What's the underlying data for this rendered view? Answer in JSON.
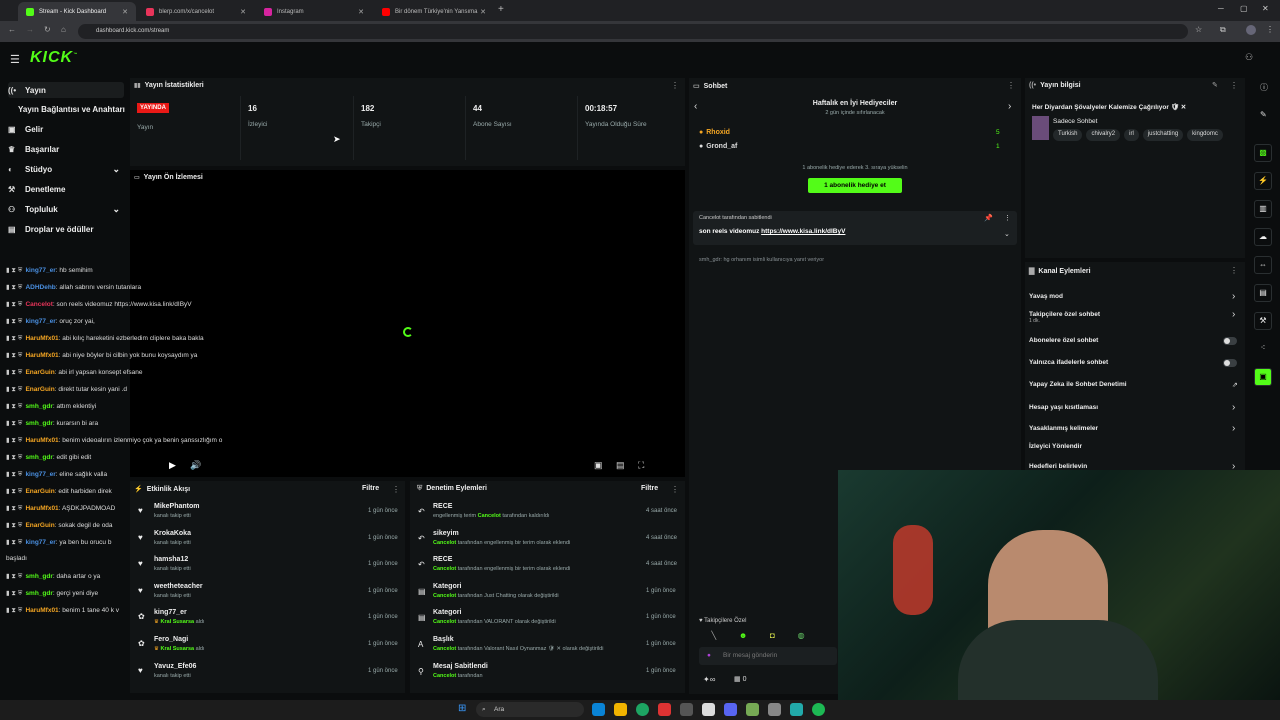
{
  "browser": {
    "tabs": [
      {
        "title": "Stream - Kick Dashboard",
        "color": "#53fc18"
      },
      {
        "title": "blerp.com/x/cancelot",
        "color": "#e8345a"
      },
      {
        "title": "Instagram",
        "color": "#d6249f"
      },
      {
        "title": "Bir dönem Türkiye'nin Yansıma",
        "color": "#ff0000"
      }
    ],
    "url": "dashboard.kick.com/stream",
    "plus": "+"
  },
  "brand": {
    "logo": "KICK",
    "tm": "™",
    "accent": "#53fc18"
  },
  "sidebar": {
    "items": [
      {
        "label": "Yayın",
        "icon": "broadcast-icon"
      },
      {
        "label": "Yayın Bağlantısı ve Anahtarı",
        "icon": ""
      },
      {
        "label": "Gelir",
        "icon": "wallet-icon"
      },
      {
        "label": "Başarılar",
        "icon": "trophy-icon"
      },
      {
        "label": "Stüdyo",
        "icon": "palette-icon"
      },
      {
        "label": "Denetleme",
        "icon": "gavel-icon"
      },
      {
        "label": "Topluluk",
        "icon": "community-icon"
      },
      {
        "label": "Droplar ve ödüller",
        "icon": "gift-icon"
      }
    ]
  },
  "stats": {
    "title": "Yayın İstatistikleri",
    "live_badge": "YAYINDA",
    "live_label": "Yayın",
    "items": [
      {
        "value": "16",
        "label": "İzleyici"
      },
      {
        "value": "182",
        "label": "Takipçi"
      },
      {
        "value": "44",
        "label": "Abone Sayısı"
      },
      {
        "value": "00:18:57",
        "label": "Yayında Olduğu Süre"
      }
    ]
  },
  "preview": {
    "title": "Yayın Ön İzlemesi"
  },
  "activity": {
    "title": "Etkinlik Akışı",
    "filter": "Filtre",
    "rows": [
      {
        "name": "MikePhantom",
        "sub": "kanalı takip etti",
        "time": "1 gün önce",
        "icon": "heart-icon"
      },
      {
        "name": "KrokaKoka",
        "sub": "kanalı takip etti",
        "time": "1 gün önce",
        "icon": "heart-icon"
      },
      {
        "name": "hamsha12",
        "sub": "kanalı takip etti",
        "time": "1 gün önce",
        "icon": "heart-icon"
      },
      {
        "name": "weetheteacher",
        "sub": "kanalı takip etti",
        "time": "1 gün önce",
        "icon": "heart-icon"
      },
      {
        "name": "king77_er",
        "sub": "Kral Susarsa",
        "sub2": "aldı",
        "time": "1 gün önce",
        "icon": "reward-icon"
      },
      {
        "name": "Fero_Nagi",
        "sub": "Kral Susarsa",
        "sub2": "aldı",
        "time": "1 gün önce",
        "icon": "reward-icon"
      },
      {
        "name": "Yavuz_Efe06",
        "sub": "kanalı takip etti",
        "time": "1 gün önce",
        "icon": "heart-icon"
      }
    ]
  },
  "moderation": {
    "title": "Denetim Eylemleri",
    "filter": "Filtre",
    "rows": [
      {
        "name": "RECE",
        "sub": "engellenmiş terim",
        "hl": "Cancelot",
        "sub2": "tarafından kaldırıldı",
        "time": "4 saat önce",
        "icon": "undo-icon"
      },
      {
        "name": "sikeyim",
        "sub": "",
        "hl": "Cancelot",
        "sub2": "tarafından engellenmiş bir terim olarak eklendi",
        "time": "4 saat önce",
        "icon": "undo-icon"
      },
      {
        "name": "RECE",
        "sub": "",
        "hl": "Cancelot",
        "sub2": "tarafından engellenmiş bir terim olarak eklendi",
        "time": "4 saat önce",
        "icon": "undo-icon"
      },
      {
        "name": "Kategori",
        "sub": "",
        "hl": "Cancelot",
        "sub2": "tarafından Just Chatting olarak değiştirildi",
        "time": "1 gün önce",
        "icon": "category-icon"
      },
      {
        "name": "Kategori",
        "sub": "",
        "hl": "Cancelot",
        "sub2": "tarafından VALORANT olarak değiştirildi",
        "time": "1 gün önce",
        "icon": "category-icon"
      },
      {
        "name": "Başlık",
        "sub": "",
        "hl": "Cancelot",
        "sub2": "tarafından Valorant Nasıl Oynanmaz 🛡 ✕ olarak değiştirildi",
        "time": "1 gün önce",
        "icon": "title-icon"
      },
      {
        "name": "Mesaj Sabitlendi",
        "sub": "",
        "hl": "Cancelot",
        "sub2": "tarafından",
        "time": "1 gün önce",
        "icon": "pin-icon"
      }
    ]
  },
  "chat": {
    "title": "Sohbet",
    "gifters_title": "Haftalık en İyi Hediyeciler",
    "gifters_sub": "2 gün içinde sıfırlanacak",
    "gifters": [
      {
        "name": "Rhoxid",
        "count": "5"
      },
      {
        "name": "Grond_af",
        "count": "1"
      }
    ],
    "gift_hint": "1 abonelik hediye ederek 3. sıraya yükselin",
    "gift_button": "1 abonelik hediye et",
    "pinned_by": "Cancelot tarafından sabitlendi",
    "pinned_text": "son reels videomuz",
    "pinned_link": "https://www.kisa.link/dIByV",
    "reply_hint": "smh_gdr: hg orhanım isimli kullanıcıya yanıt veriyor",
    "messages": [
      {
        "user": "king77_er",
        "text": "hb semihim",
        "color": "#4a90e2"
      },
      {
        "user": "ADHDehb",
        "text": "allah sabrını versin tutanlara",
        "color": "#4a90e2"
      },
      {
        "user": "Cancelot",
        "text": "son reels videomuz https://www.kisa.link/dIByV",
        "color": "#e8345a"
      },
      {
        "user": "king77_er",
        "text": "oruç zor yai,",
        "color": "#4a90e2"
      },
      {
        "user": "HaruMfx01",
        "text": "abi kılıç hareketini ezberledim cliplere baka bakla",
        "color": "#f5a623"
      },
      {
        "user": "HaruMfx01",
        "text": "abi niye böyler bi cilbin yok bunu koysaydım ya",
        "color": "#f5a623"
      },
      {
        "user": "EnarGuin",
        "text": "abi irl yapsan konsept efsane",
        "color": "#f5a623"
      },
      {
        "user": "EnarGuin",
        "text": "direkt tutar kesin yani .d",
        "color": "#f5a623"
      },
      {
        "user": "smh_gdr",
        "text": "attım eklentiyi",
        "color": "#53fc18"
      },
      {
        "user": "smh_gdr",
        "text": "kurarsın bi ara",
        "color": "#53fc18"
      },
      {
        "user": "HaruMfx01",
        "text": "benim videoalırın izlenmiyo çok ya benin şanssızlığım o",
        "color": "#f5a623"
      },
      {
        "user": "smh_gdr",
        "text": "edit gibi edit",
        "color": "#53fc18"
      },
      {
        "user": "king77_er",
        "text": "eline sağlık valla",
        "color": "#4a90e2"
      },
      {
        "user": "EnarGuin",
        "text": "edit harbiden direk",
        "color": "#f5a623"
      },
      {
        "user": "HaruMfx01",
        "text": "AŞDKJPADMOAD",
        "color": "#f5a623"
      },
      {
        "user": "EnarGuin",
        "text": "sokak degil de oda",
        "color": "#f5a623"
      },
      {
        "user": "king77_er",
        "text": "ya ben bu orucu b",
        "color": "#4a90e2"
      },
      {
        "user": "",
        "text": "başladı",
        "color": "#ddd"
      },
      {
        "user": "smh_gdr",
        "text": "daha artar o ya",
        "color": "#53fc18"
      },
      {
        "user": "smh_gdr",
        "text": "gerçi yeni diye",
        "color": "#53fc18"
      },
      {
        "user": "HaruMfx01",
        "text": "benim 1 tane 40 k v",
        "color": "#f5a623"
      }
    ],
    "follow_only": "Takipçilere Özel",
    "input_placeholder": "Bir mesaj gönderin",
    "counter_right": "0"
  },
  "info": {
    "title": "Yayın bilgisi",
    "stream_title": "Her Diyardan Şövalyeler Kalemize Çağrılıyor 🛡 ✕",
    "category": "Sadece Sohbet",
    "tags": [
      "Turkish",
      "chivalry2",
      "irl",
      "justchatting",
      "kingdomc"
    ]
  },
  "channel_actions": {
    "title": "Kanal Eylemleri",
    "items": [
      {
        "label": "Yavaş mod",
        "control": "chevron"
      },
      {
        "label": "Takipçilere özel sohbet",
        "sub": "1 dk.",
        "control": "chevron"
      },
      {
        "label": "Abonelere özel sohbet",
        "control": "toggle"
      },
      {
        "label": "Yalnızca ifadelerle sohbet",
        "control": "toggle"
      },
      {
        "label": "Yapay Zeka ile Sohbet Denetimi",
        "control": "external"
      },
      {
        "label": "Hesap yaşı kısıtlaması",
        "control": "chevron"
      },
      {
        "label": "Yasaklanmış kelimeler",
        "control": "chevron"
      },
      {
        "label": "İzleyici Yönlendir",
        "control": ""
      },
      {
        "label": "Hedefleri belirlevin",
        "control": "chevron"
      }
    ]
  },
  "taskbar": {
    "search": "Ara"
  }
}
